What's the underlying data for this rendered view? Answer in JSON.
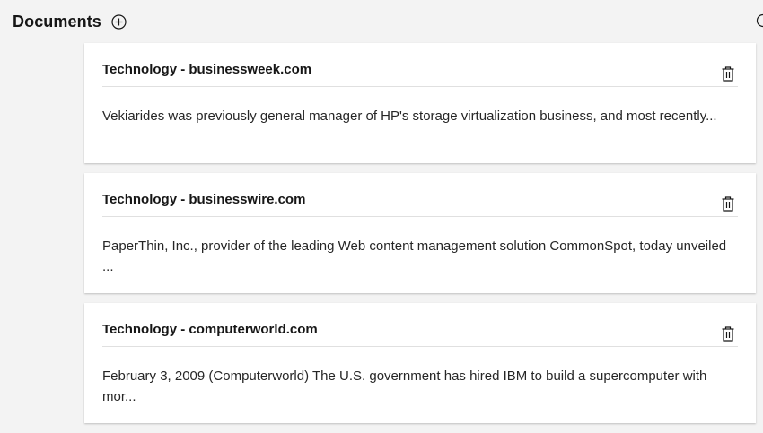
{
  "header": {
    "title": "Documents",
    "add_icon": "add-circle-icon",
    "edge_icon": "circle-icon"
  },
  "documents": [
    {
      "title": "Technology - businessweek.com",
      "snippet": "Vekiarides was previously general manager of HP's storage virtualization business, and most recently...",
      "delete_icon": "trash-icon"
    },
    {
      "title": "Technology - businesswire.com",
      "snippet": "PaperThin, Inc., provider of the leading Web content management solution CommonSpot, today unveiled ...",
      "delete_icon": "trash-icon"
    },
    {
      "title": "Technology - computerworld.com",
      "snippet": "February 3, 2009 (Computerworld) The U.S. government has hired IBM to build a supercomputer with mor...",
      "delete_icon": "trash-icon"
    }
  ]
}
